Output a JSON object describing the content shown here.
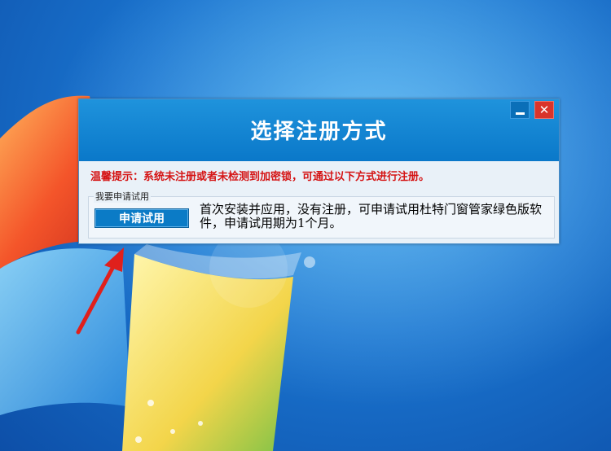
{
  "dialog": {
    "title": "选择注册方式",
    "notice": "温馨提示：系统未注册或者未检测到加密锁，可通过以下方式进行注册。",
    "trial_group_label": "我要申请试用",
    "trial_button_label": "申请试用",
    "trial_description": "首次安装并应用，没有注册，可申请试用杜特门窗管家绿色版软件，申请试用期为1个月。",
    "close_label": "✕"
  },
  "icons": {
    "minimize": "minimize-icon",
    "close": "close-icon",
    "arrow": "red-arrow-annotation"
  },
  "colors": {
    "title_bar": "#0a78c9",
    "notice_text": "#d51414",
    "close_button": "#d9342b",
    "trial_button": "#0b7bc6",
    "arrow": "#e0201c"
  }
}
